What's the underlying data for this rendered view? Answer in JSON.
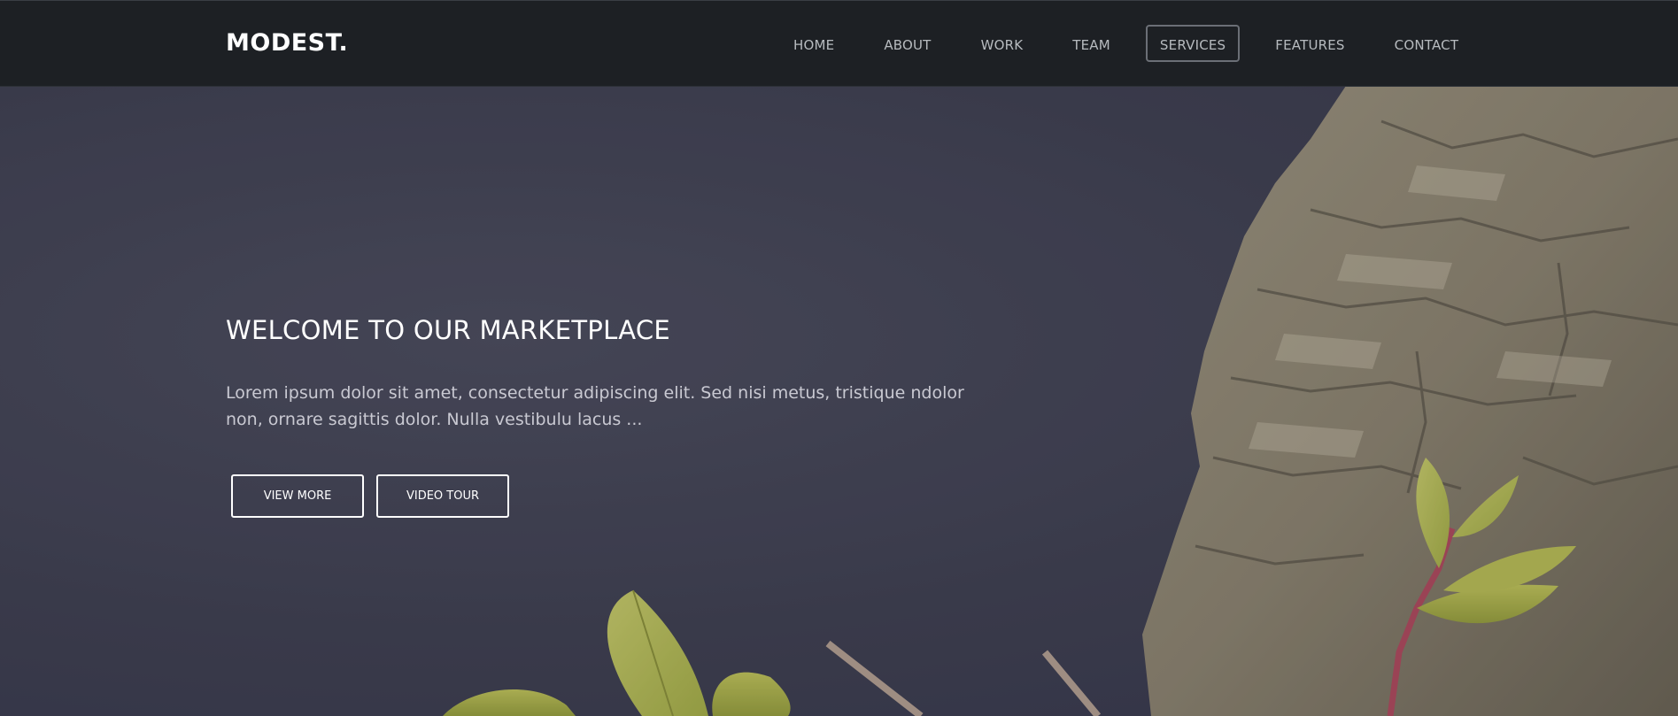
{
  "navbar": {
    "logo": "MODEST.",
    "items": [
      {
        "label": "HOME"
      },
      {
        "label": "ABOUT"
      },
      {
        "label": "WORK"
      },
      {
        "label": "TEAM"
      },
      {
        "label": "SERVICES",
        "active": true
      },
      {
        "label": "FEATURES"
      },
      {
        "label": "CONTACT"
      }
    ]
  },
  "hero": {
    "title": "WELCOME TO OUR MARKETPLACE",
    "text": "Lorem ipsum dolor sit amet, consectetur adipiscing elit. Sed nisi metus, tristique ndolor non, ornare sagittis dolor. Nulla vestibulu lacus ...",
    "buttons": {
      "view_more": "VIEW MORE",
      "video_tour": "VIDEO TOUR"
    }
  },
  "colors": {
    "navbar_bg": "#1d2024",
    "hero_overlay": "#3e3f4f",
    "accent_border": "#6b6f76",
    "text_white": "#ffffff"
  }
}
